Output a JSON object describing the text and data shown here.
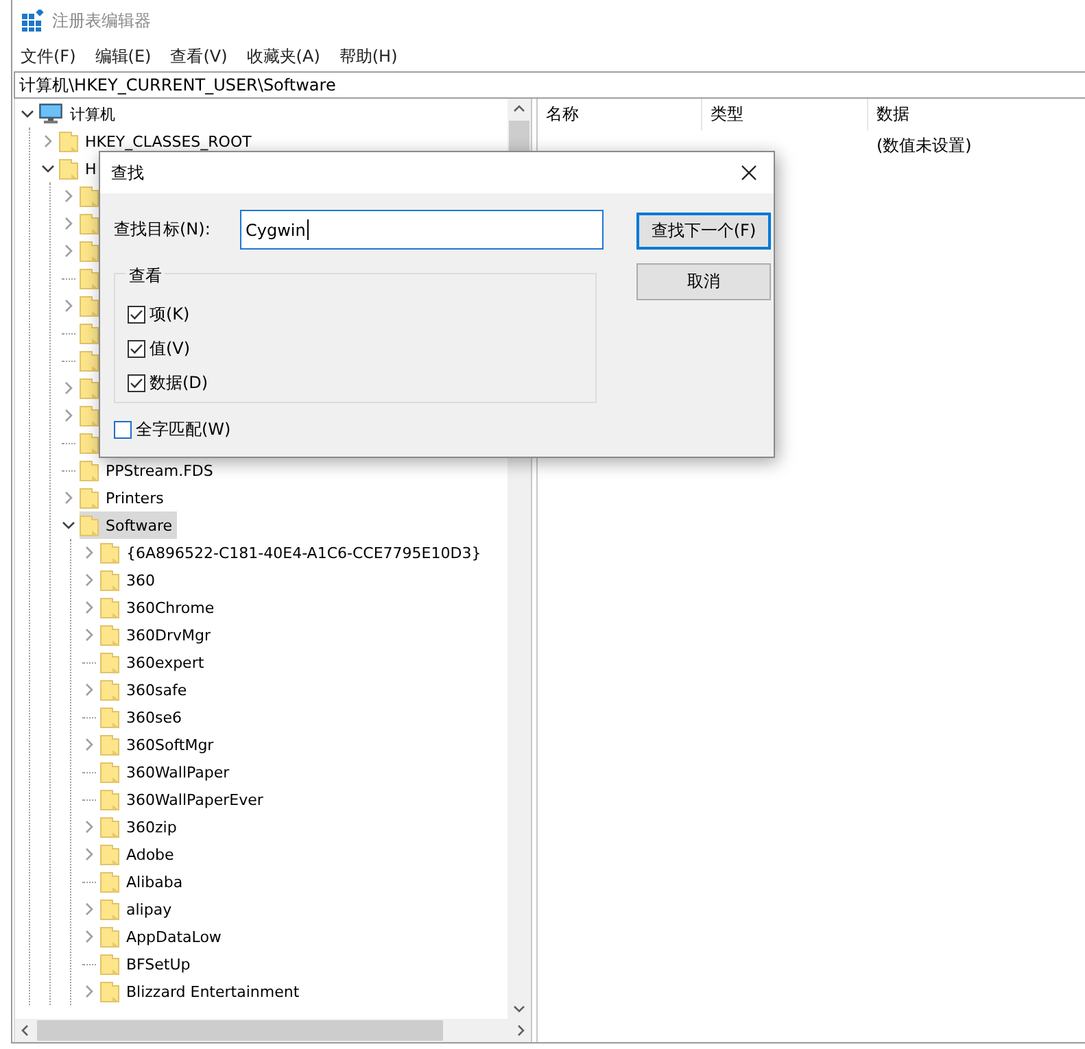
{
  "window": {
    "title": "注册表编辑器"
  },
  "menu": [
    "文件(F)",
    "编辑(E)",
    "查看(V)",
    "收藏夹(A)",
    "帮助(H)"
  ],
  "address": "计算机\\HKEY_CURRENT_USER\\Software",
  "tree": [
    {
      "label": "计算机",
      "kind": "computer",
      "expandable": true,
      "expanded": true,
      "selected": false,
      "children": [
        {
          "label": "HKEY_CLASSES_ROOT",
          "kind": "folder",
          "expandable": true,
          "expanded": false,
          "selected": false
        },
        {
          "label": "H",
          "kind": "folder",
          "expandable": true,
          "expanded": true,
          "selected": false,
          "children": [
            {
              "kind": "folder",
              "expandable": true,
              "expanded": false,
              "selected": false
            },
            {
              "kind": "folder",
              "expandable": true,
              "expanded": false,
              "selected": false
            },
            {
              "kind": "folder",
              "expandable": true,
              "expanded": false,
              "selected": false
            },
            {
              "kind": "folder",
              "expandable": false,
              "selected": false
            },
            {
              "kind": "folder",
              "expandable": true,
              "expanded": false,
              "selected": false
            },
            {
              "kind": "folder",
              "expandable": false,
              "selected": false
            },
            {
              "kind": "folder",
              "expandable": false,
              "selected": false
            },
            {
              "kind": "folder",
              "expandable": true,
              "expanded": false,
              "selected": false
            },
            {
              "kind": "folder",
              "expandable": true,
              "expanded": false,
              "selected": false
            },
            {
              "kind": "folder",
              "expandable": false,
              "selected": false
            },
            {
              "label": "PPStream.FDS",
              "kind": "folder",
              "expandable": false,
              "selected": false
            },
            {
              "label": "Printers",
              "kind": "folder",
              "expandable": true,
              "expanded": false,
              "selected": false
            },
            {
              "label": "Software",
              "kind": "folder",
              "expandable": true,
              "expanded": true,
              "selected": true,
              "children": [
                {
                  "label": "{6A896522-C181-40E4-A1C6-CCE7795E10D3}",
                  "kind": "folder",
                  "expandable": true,
                  "expanded": false,
                  "selected": false
                },
                {
                  "label": "360",
                  "kind": "folder",
                  "expandable": true,
                  "expanded": false,
                  "selected": false
                },
                {
                  "label": "360Chrome",
                  "kind": "folder",
                  "expandable": true,
                  "expanded": false,
                  "selected": false
                },
                {
                  "label": "360DrvMgr",
                  "kind": "folder",
                  "expandable": true,
                  "expanded": false,
                  "selected": false
                },
                {
                  "label": "360expert",
                  "kind": "folder",
                  "expandable": false,
                  "selected": false
                },
                {
                  "label": "360safe",
                  "kind": "folder",
                  "expandable": true,
                  "expanded": false,
                  "selected": false
                },
                {
                  "label": "360se6",
                  "kind": "folder",
                  "expandable": false,
                  "selected": false
                },
                {
                  "label": "360SoftMgr",
                  "kind": "folder",
                  "expandable": true,
                  "expanded": false,
                  "selected": false
                },
                {
                  "label": "360WallPaper",
                  "kind": "folder",
                  "expandable": false,
                  "selected": false
                },
                {
                  "label": "360WallPaperEver",
                  "kind": "folder",
                  "expandable": false,
                  "selected": false
                },
                {
                  "label": "360zip",
                  "kind": "folder",
                  "expandable": true,
                  "expanded": false,
                  "selected": false
                },
                {
                  "label": "Adobe",
                  "kind": "folder",
                  "expandable": true,
                  "expanded": false,
                  "selected": false
                },
                {
                  "label": "Alibaba",
                  "kind": "folder",
                  "expandable": false,
                  "selected": false
                },
                {
                  "label": "alipay",
                  "kind": "folder",
                  "expandable": true,
                  "expanded": false,
                  "selected": false
                },
                {
                  "label": "AppDataLow",
                  "kind": "folder",
                  "expandable": true,
                  "expanded": false,
                  "selected": false
                },
                {
                  "label": "BFSetUp",
                  "kind": "folder",
                  "expandable": false,
                  "selected": false
                },
                {
                  "label": "Blizzard Entertainment",
                  "kind": "folder",
                  "expandable": true,
                  "expanded": false,
                  "selected": false
                }
              ]
            }
          ]
        }
      ]
    }
  ],
  "values": {
    "columns": [
      "名称",
      "类型",
      "数据"
    ],
    "rows": [
      {
        "data": "(数值未设置)"
      }
    ]
  },
  "dialog": {
    "title": "查找",
    "target_label": "查找目标(N):",
    "target_value": "Cygwin",
    "group_label": "查看",
    "options": [
      {
        "label": "项(K)",
        "checked": true
      },
      {
        "label": "值(V)",
        "checked": true
      },
      {
        "label": "数据(D)",
        "checked": true
      }
    ],
    "whole_word": {
      "label": "全字匹配(W)",
      "checked": false
    },
    "buttons": [
      {
        "label": "查找下一个(F)",
        "default": true
      },
      {
        "label": "取消",
        "default": false
      }
    ]
  }
}
